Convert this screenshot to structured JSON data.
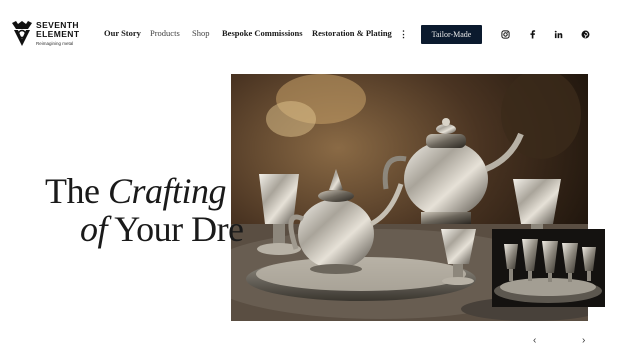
{
  "brand": {
    "name_line1": "SEVENTH",
    "name_line2": "ELEMENT",
    "tagline": "Reimagining metal"
  },
  "nav": {
    "items": [
      {
        "label": "Our Story"
      },
      {
        "label": "Products"
      },
      {
        "label": "Shop"
      },
      {
        "label": "Bespoke Commissions"
      },
      {
        "label": "Restoration & Plating"
      }
    ],
    "more_label": "⋮",
    "cta_label": "Tailor-Made"
  },
  "social": [
    "instagram-icon",
    "facebook-icon",
    "linkedin-icon",
    "pinterest-icon"
  ],
  "hero": {
    "word_the": "The",
    "word_crafting": "Crafting",
    "word_of": "of",
    "word_your": "Your Dre"
  },
  "carousel": {
    "prev_label": "‹",
    "next_label": "›"
  },
  "colors": {
    "cta_bg": "#0b1a2e",
    "text": "#1a1a1a"
  }
}
